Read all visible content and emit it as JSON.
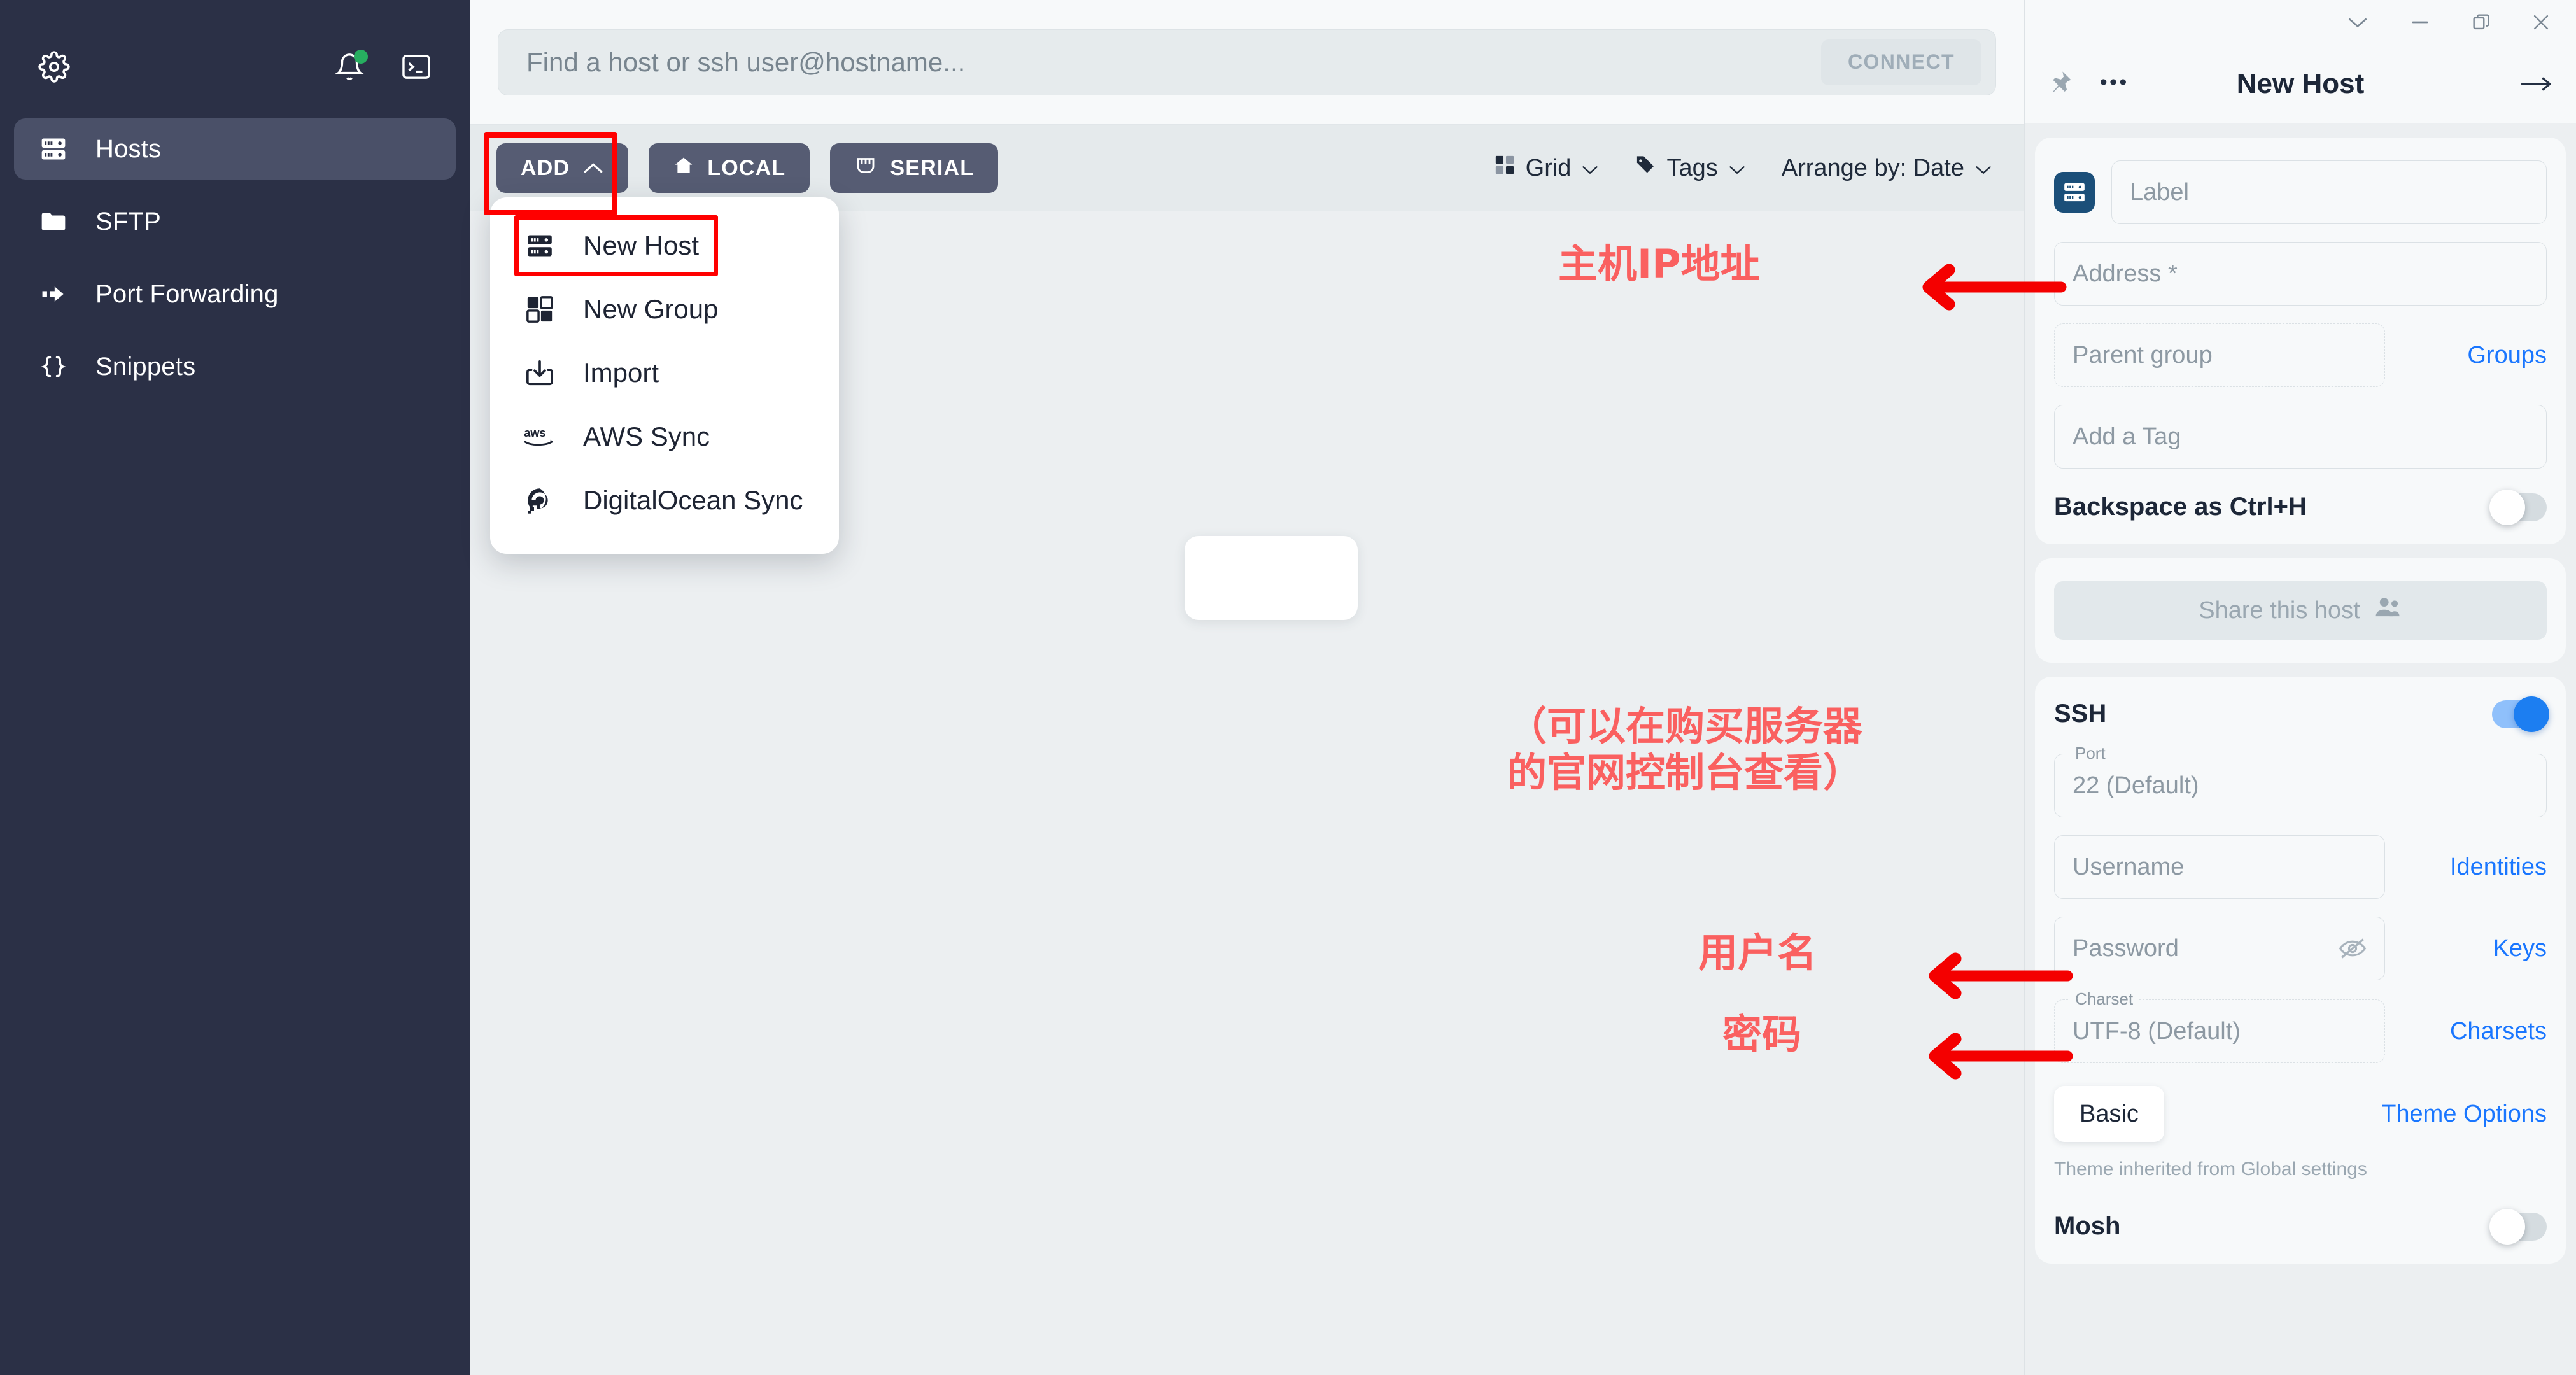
{
  "sidebar": {
    "gear_icon": "gear-icon",
    "bell_icon": "bell-icon",
    "terminal_icon": "terminal-icon",
    "items": [
      {
        "label": "Hosts",
        "icon": "server-icon",
        "active": true
      },
      {
        "label": "SFTP",
        "icon": "folder-icon",
        "active": false
      },
      {
        "label": "Port Forwarding",
        "icon": "arrow-forward-icon",
        "active": false
      },
      {
        "label": "Snippets",
        "icon": "braces-icon",
        "active": false
      }
    ]
  },
  "search": {
    "placeholder": "Find a host or ssh user@hostname...",
    "value": "",
    "connect_label": "CONNECT"
  },
  "toolbar": {
    "add_label": "ADD",
    "local_label": "LOCAL",
    "serial_label": "SERIAL",
    "grid_label": "Grid",
    "tags_label": "Tags",
    "arrange_label": "Arrange by: Date"
  },
  "dropdown": {
    "items": [
      {
        "label": "New Host",
        "icon": "server-icon",
        "highlighted": true
      },
      {
        "label": "New Group",
        "icon": "group-blocks-icon",
        "highlighted": false
      },
      {
        "label": "Import",
        "icon": "import-icon",
        "highlighted": false
      },
      {
        "label": "AWS Sync",
        "icon": "aws-icon",
        "highlighted": false
      },
      {
        "label": "DigitalOcean Sync",
        "icon": "digitalocean-icon",
        "highlighted": false
      }
    ]
  },
  "annotations": {
    "accent_color": "#fa6060",
    "arrow_color": "#f40000",
    "highlight_color": "#ff0000",
    "ip_address": "主机IP地址",
    "note": "（可以在购买服务器\n的官网控制台查看）",
    "username": "用户名",
    "password": "密码"
  },
  "panel": {
    "title": "New Host",
    "pin_icon": "pin-icon",
    "more_icon": "more-dots-icon",
    "forward_icon": "arrow-right-icon",
    "window": {
      "collapse_icon": "chevron-down-icon",
      "minimize_icon": "minimize-icon",
      "restore_icon": "restore-icon",
      "close_icon": "close-icon"
    },
    "host_icon": "server-icon",
    "label_field": {
      "placeholder": "Label",
      "value": ""
    },
    "address_field": {
      "placeholder": "Address *",
      "value": ""
    },
    "parent_group_field": {
      "placeholder": "Parent group",
      "value": ""
    },
    "groups_link": "Groups",
    "tag_field": {
      "placeholder": "Add a Tag",
      "value": ""
    },
    "backspace_label": "Backspace as Ctrl+H",
    "backspace_on": false,
    "share_label": "Share this host",
    "share_icon": "people-icon",
    "ssh_label": "SSH",
    "ssh_on": true,
    "port_legend": "Port",
    "port_value": "22 (Default)",
    "username_field": {
      "placeholder": "Username",
      "value": ""
    },
    "identities_link": "Identities",
    "password_field": {
      "placeholder": "Password",
      "value": ""
    },
    "password_eye_icon": "eye-off-icon",
    "keys_link": "Keys",
    "charset_legend": "Charset",
    "charset_value": "UTF-8 (Default)",
    "charsets_link": "Charsets",
    "basic_label": "Basic",
    "theme_options_link": "Theme Options",
    "theme_hint": "Theme inherited from Global settings",
    "mosh_label": "Mosh",
    "mosh_on": false
  }
}
